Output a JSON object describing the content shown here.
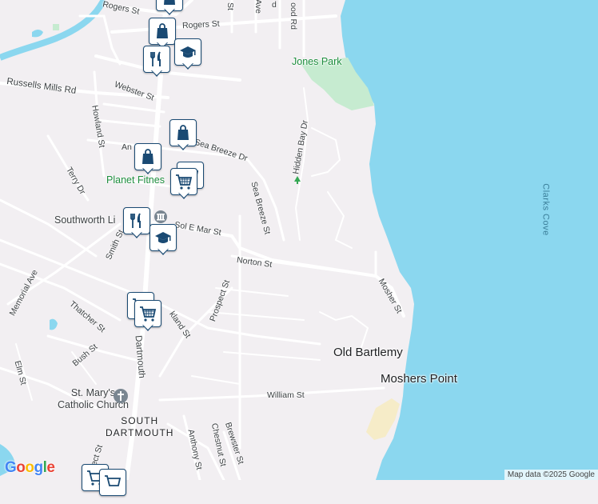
{
  "map": {
    "colors": {
      "water": "#8bd7ef",
      "land": "#f2eff2",
      "road": "#ffffff",
      "park": "#c6ebd0",
      "sand": "#f6ecc8",
      "pin": "#1a4a73"
    },
    "streets": {
      "rogers_st_top": "Rogers St",
      "rogers_st": "Rogers St",
      "webster_st": "Webster St",
      "russells_mills_rd": "Russells Mills Rd",
      "howland_st": "Howland St",
      "terry_dr": "Terry Dr",
      "an": "An",
      "sea_breeze_dr": "Sea Breeze Dr",
      "sea_breeze_st": "Sea Breeze St",
      "hidden_bay_dr": "Hidden Bay Dr",
      "sol_e_mar_st": "Sol E Mar St",
      "smith_st": "Smith St",
      "norton_st": "Norton St",
      "mosher_st": "Mosher St",
      "memorial_ave": "Memorial Ave",
      "thatcher_st": "Thatcher St",
      "prospect_st": "Prospect St",
      "kland_st": "kland St",
      "bush_st": "Bush St",
      "dartmouth": "Dartmouth",
      "elm_st": "Elm St",
      "william_st": "William St",
      "anthony_st": "Anthony St",
      "chestnut_st": "Chestnut St",
      "brewster_st": "Brewster St",
      "pect_st": "pect St",
      "ave_top": "Ave",
      "st_top": "St",
      "ood_rd": "ood Rd",
      "d_top": "d"
    },
    "places": {
      "jones_park": "Jones Park",
      "planet_fitness": "Planet Fitnes",
      "southworth_library": "Southworth Li",
      "old_bartlemy": "Old Bartlemy",
      "moshers_point": "Moshers Point",
      "clarks_cove": "Clarks Cove",
      "st_marys_line1": "St. Mary's",
      "st_marys_line2": "Catholic Church",
      "south_dartmouth_line1": "SOUTH",
      "south_dartmouth_line2": "DARTMOUTH"
    },
    "pins": [
      "shopping-bag",
      "restaurant",
      "school",
      "shopping-bag",
      "shopping-bag",
      "shopping-cart",
      "restaurant",
      "school",
      "shopping-cart",
      "shopping-cart"
    ],
    "logo": {
      "text": "Google",
      "colors": [
        "#4285f4",
        "#ea4335",
        "#fbbc05",
        "#4285f4",
        "#34a853",
        "#ea4335"
      ]
    },
    "attribution": "Map data ©2025 Google"
  }
}
